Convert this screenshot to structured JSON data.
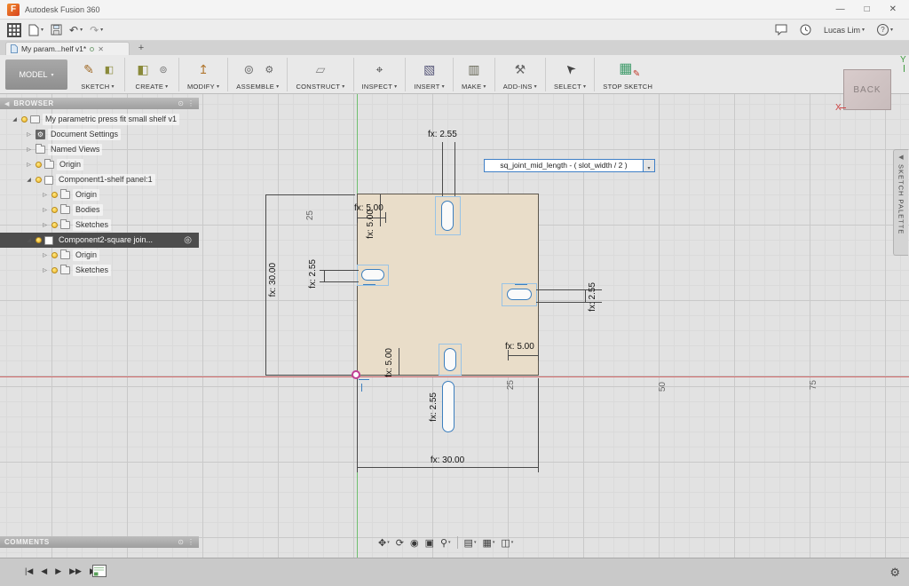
{
  "titlebar": {
    "logo": "F",
    "app_title": "Autodesk Fusion 360",
    "minimize": "—",
    "maximize": "□",
    "close": "✕"
  },
  "qat": {
    "user": "Lucas Lim",
    "help": "?"
  },
  "tabbar": {
    "tab_label": "My param...helf v1*",
    "close": "✕",
    "new_tab": "+"
  },
  "ribbon": {
    "workspace": "MODEL",
    "groups": [
      "SKETCH",
      "CREATE",
      "MODIFY",
      "ASSEMBLE",
      "CONSTRUCT",
      "INSPECT",
      "INSERT",
      "MAKE",
      "ADD-INS",
      "SELECT"
    ],
    "stop_sketch": "STOP SKETCH"
  },
  "browser": {
    "title": "BROWSER",
    "items": [
      {
        "label": "My parametric press fit small shelf v1"
      },
      {
        "label": "Document Settings"
      },
      {
        "label": "Named Views"
      },
      {
        "label": "Origin"
      },
      {
        "label": "Component1-shelf panel:1"
      },
      {
        "label": "Origin"
      },
      {
        "label": "Bodies"
      },
      {
        "label": "Sketches"
      },
      {
        "label": "Component2-square join..."
      },
      {
        "label": "Origin"
      },
      {
        "label": "Sketches"
      }
    ]
  },
  "comments": {
    "title": "COMMENTS"
  },
  "viewcube": {
    "face": "BACK",
    "axis_x": "X",
    "axis_y": "Y"
  },
  "sketch_palette": {
    "label": "SKETCH PALETTE"
  },
  "sketch": {
    "expression": "sq_joint_mid_length - ( slot_width / 2 )",
    "dims": {
      "slot_top": "fx: 2.55",
      "slot_left": "fx: 2.55",
      "slot_right": "fx: 2.55",
      "slot_bottom": "fx: 2.55",
      "top_left_h": "fx: 5.00",
      "top_left_v": "fx: 5.00",
      "bottom_left_v": "fx: 5.00",
      "bottom_right_h": "fx: 5.00",
      "height": "fx: 30.00",
      "width": "fx: 30.00"
    },
    "grid_labels": {
      "y25": "25",
      "x25": "25",
      "x50": "50",
      "x75": "75"
    }
  },
  "playback": [
    "|◀",
    "◀",
    "▶",
    "▶▶",
    "▶|"
  ],
  "icons": {
    "caret": "▾",
    "tri_expanded": "◢",
    "tri_collapsed": "▷",
    "gear": "⚙",
    "undo": "↶",
    "redo": "↷",
    "target": "◎",
    "collapse_left": "◀",
    "panel_ring": "⊙",
    "panel_menu": "⋮",
    "sketch": "✎",
    "create": "◧",
    "modify": "↥",
    "assemble1": "⊚",
    "assemble2": "⚙",
    "construct": "▱",
    "inspect": "⌖",
    "insert": "▧",
    "make": "▥",
    "addins": "⚒",
    "select": "➤",
    "stop_grid": "▦",
    "stop_pencil": "✎",
    "pan": "✥",
    "orbit": "⟳",
    "look_at": "◉",
    "zoom_window": "▣",
    "zoom": "⚲",
    "display": "▤",
    "grid": "▦",
    "viewports": "◫"
  }
}
